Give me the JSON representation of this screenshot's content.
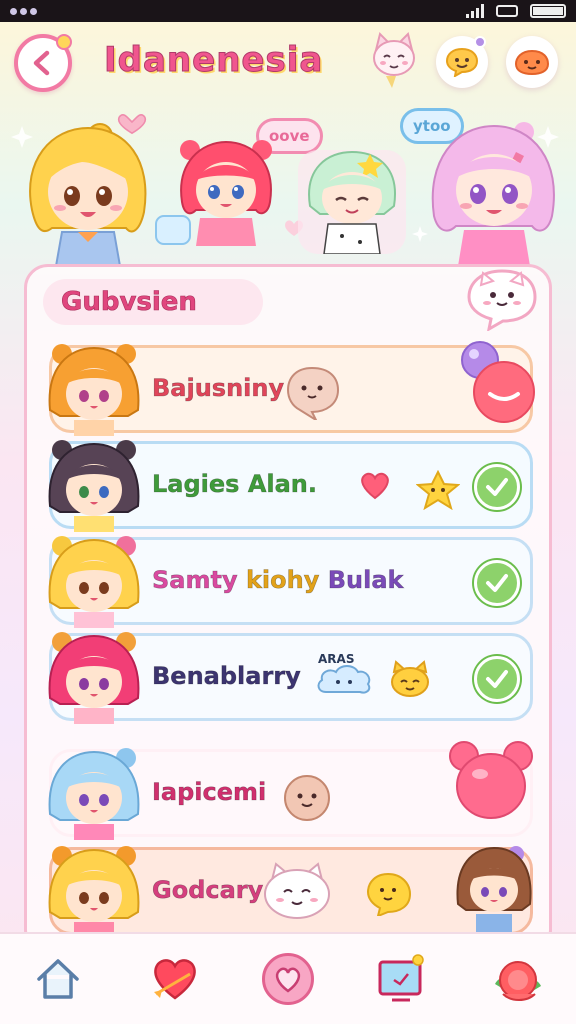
{
  "app": {
    "title": "Idanenesia"
  },
  "hero": {
    "bubble_left": "oove",
    "bubble_right": "ytoo"
  },
  "section": {
    "label": "Gubvsien"
  },
  "list": [
    {
      "name": "Bajusniny",
      "color": "#e0455a",
      "status": "pink-blob"
    },
    {
      "name": "Lagies Alan.",
      "color": "#3f9b3a",
      "status": "checked"
    },
    {
      "name": "Samty",
      "name2": "kiohy",
      "name3": "Bulak",
      "color": "#d94aa0",
      "status": "checked"
    },
    {
      "name": "Benablarry",
      "badge": "ARAS",
      "color": "#3c3470",
      "status": "checked"
    },
    {
      "name": "Iapicemi",
      "color": "#d0306e",
      "status": "bear-balloon"
    },
    {
      "name": "Godcary",
      "color": "#d53f7e",
      "status": "avatar"
    }
  ],
  "colors": {
    "accent_pink": "#f27aa4",
    "check_green": "#8dd26b",
    "panel_border": "#f6bcd2"
  },
  "tabs": [
    {
      "icon": "home-icon"
    },
    {
      "icon": "heart-arrow-icon"
    },
    {
      "icon": "heart-circle-icon"
    },
    {
      "icon": "tv-icon"
    },
    {
      "icon": "flower-icon"
    }
  ]
}
